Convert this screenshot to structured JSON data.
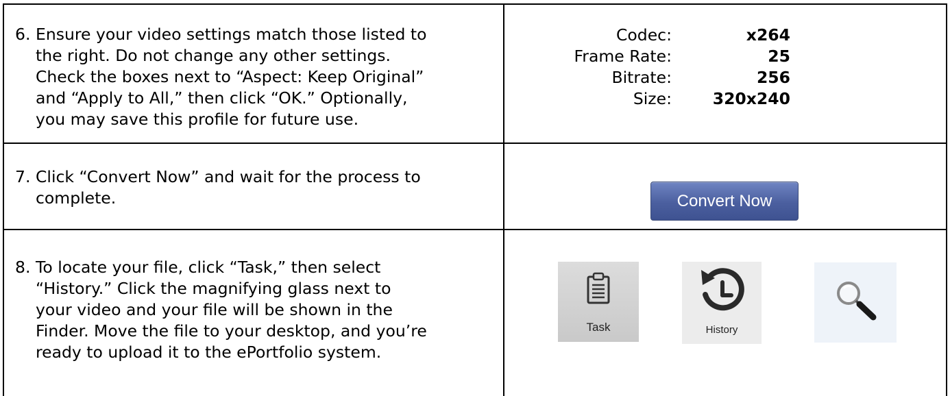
{
  "steps": [
    {
      "number": "6.",
      "text": "Ensure your video settings match those listed to\nthe right.  Do not change any other settings.\nCheck the boxes next to “Aspect: Keep Original”\nand “Apply to All,” then click “OK.” Optionally,\nyou may save this profile for future use."
    },
    {
      "number": "7.",
      "text": "Click “Convert Now” and wait for the process to\ncomplete."
    },
    {
      "number": "8.",
      "text": "To locate your file, click “Task,” then select\n“History.” Click the magnifying glass next to\nyour video and your file will be shown in the\nFinder. Move the file to your desktop, and you’re\nready to upload it to the ePortfolio system."
    }
  ],
  "settings": [
    {
      "label": "Codec:",
      "value": "x264"
    },
    {
      "label": "Frame Rate:",
      "value": "25"
    },
    {
      "label": "Bitrate:",
      "value": "256"
    },
    {
      "label": "Size:",
      "value": "320x240"
    }
  ],
  "convert_button": {
    "label": "Convert Now"
  },
  "icons": {
    "task": {
      "label": "Task",
      "icon": "clipboard-icon"
    },
    "history": {
      "label": "History",
      "icon": "history-clock-icon"
    },
    "search": {
      "icon": "magnifying-glass-icon"
    }
  }
}
